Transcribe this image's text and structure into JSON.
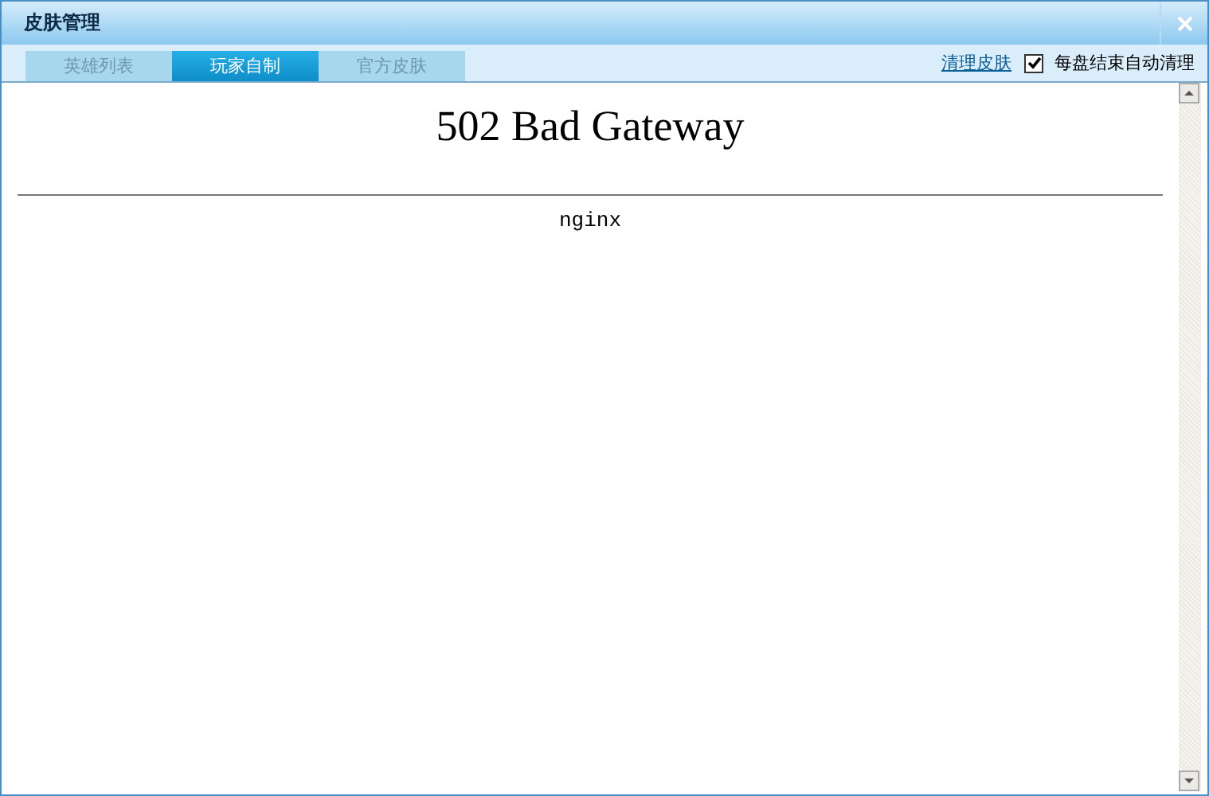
{
  "window": {
    "title": "皮肤管理"
  },
  "tabs": [
    {
      "label": "英雄列表",
      "selected": false
    },
    {
      "label": "玩家自制",
      "selected": true
    },
    {
      "label": "官方皮肤",
      "selected": false
    }
  ],
  "clean_link": "清理皮肤",
  "auto_clean": {
    "label": "每盘结束自动清理",
    "checked": true
  },
  "page": {
    "heading": "502 Bad Gateway",
    "server": "nginx"
  }
}
